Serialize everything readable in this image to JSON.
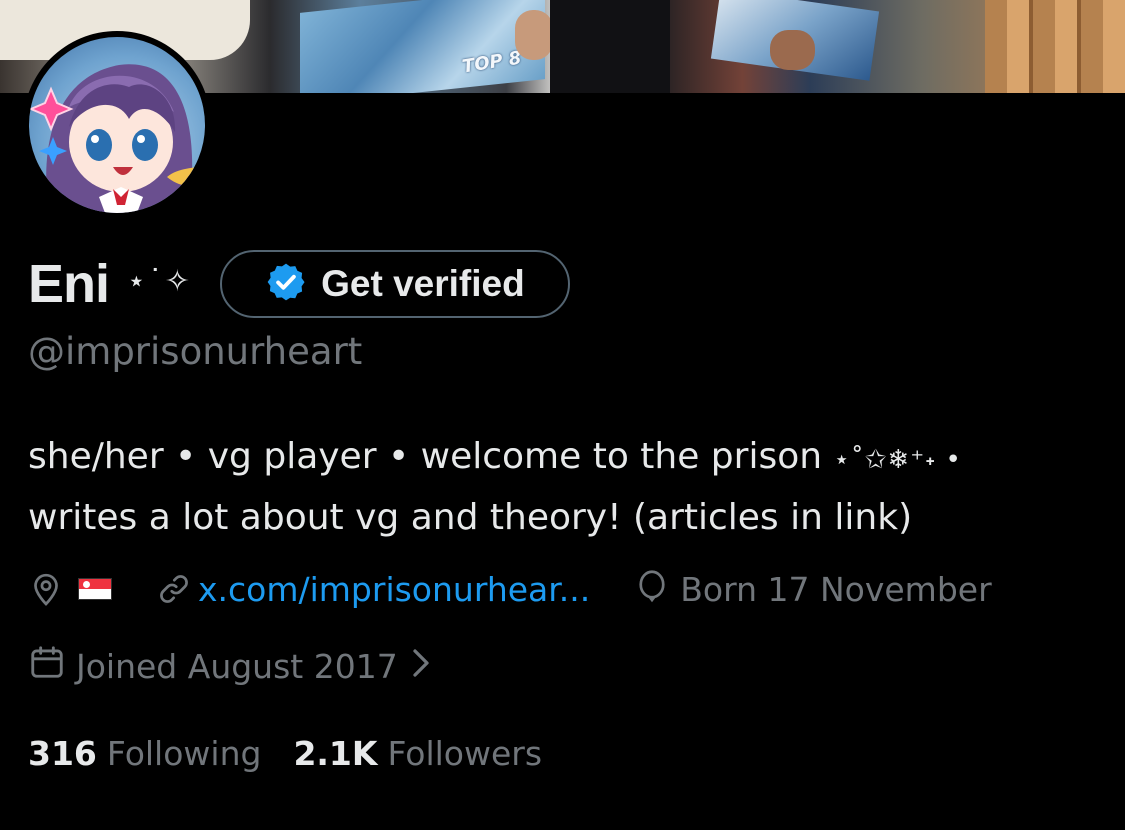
{
  "banner": {
    "poster_text": "TOP 8"
  },
  "profile": {
    "display_name": "Eni",
    "name_decoration": "⋆˙✧",
    "verify_button_label": "Get verified",
    "handle": "@imprisonurheart",
    "bio_line_1": "she/her • vg player • welcome to the prison ",
    "bio_line_1_decoration": "⋆˚✩❄︎⁺˖ •",
    "bio_line_2": "writes a lot about vg and theory! (articles in link)",
    "location_flag": "🇸🇬",
    "website": "x.com/imprisonurhear...",
    "birthday": "Born 17 November",
    "joined": "Joined August 2017",
    "following_count": "316",
    "following_label": "Following",
    "followers_count": "2.1K",
    "followers_label": "Followers"
  },
  "icons": {
    "verified": "verified-badge-icon",
    "location": "location-pin-icon",
    "link": "link-icon",
    "birthday": "balloon-icon",
    "calendar": "calendar-icon",
    "chevron": "chevron-right-icon"
  },
  "colors": {
    "background": "#000000",
    "primary_text": "#e7e9ea",
    "secondary_text": "#71767b",
    "link": "#1d9bf0",
    "button_border": "#536471"
  }
}
